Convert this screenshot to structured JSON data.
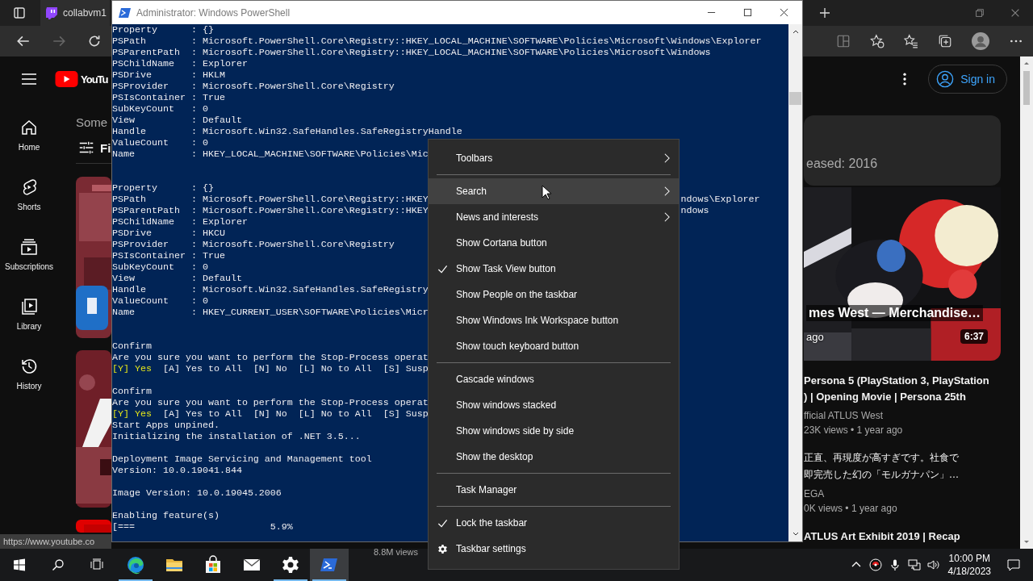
{
  "browser": {
    "tab_title": "collabvm1",
    "status_url": "https://www.youtube.co"
  },
  "youtube": {
    "logo_text": "YouTu",
    "sign_in": "Sign in",
    "sidebar": [
      {
        "kind": "home",
        "label": "Home"
      },
      {
        "kind": "shorts",
        "label": "Shorts"
      },
      {
        "kind": "subscriptions",
        "label": "Subscriptions"
      },
      {
        "kind": "library",
        "label": "Library"
      },
      {
        "kind": "history",
        "label": "History"
      }
    ],
    "left_heading": "Some",
    "left_filter": "Fi",
    "card_text": "eased: 2016",
    "video": {
      "overlay_title": "mes West — Merchandise…",
      "overlay_age": "ago",
      "duration": "6:37"
    },
    "results": [
      {
        "title_lines": [
          "Persona 5 (PlayStation 3, PlayStation",
          ") | Opening Movie | Persona 25th"
        ],
        "channel": "fficial ATLUS West",
        "meta": "23K views • 1 year ago"
      },
      {
        "title_lines": [
          "正直、再現度が高すぎです。社食で",
          "即完売した幻の「モルガナパン」…"
        ],
        "channel": "EGA",
        "meta": "0K views • 1 year ago"
      }
    ],
    "last_title": "ATLUS Art Exhibit 2019 | Recap",
    "bottom_views": "8.8M views"
  },
  "powershell": {
    "title": "Administrator: Windows PowerShell",
    "lines": [
      {
        "kind": "text",
        "text": "Property      : {}"
      },
      {
        "kind": "text",
        "text": "PSPath        : Microsoft.PowerShell.Core\\Registry::HKEY_LOCAL_MACHINE\\SOFTWARE\\Policies\\Microsoft\\Windows\\Explorer"
      },
      {
        "kind": "text",
        "text": "PSParentPath  : Microsoft.PowerShell.Core\\Registry::HKEY_LOCAL_MACHINE\\SOFTWARE\\Policies\\Microsoft\\Windows"
      },
      {
        "kind": "text",
        "text": "PSChildName   : Explorer"
      },
      {
        "kind": "text",
        "text": "PSDrive       : HKLM"
      },
      {
        "kind": "text",
        "text": "PSProvider    : Microsoft.PowerShell.Core\\Registry"
      },
      {
        "kind": "text",
        "text": "PSIsContainer : True"
      },
      {
        "kind": "text",
        "text": "SubKeyCount   : 0"
      },
      {
        "kind": "text",
        "text": "View          : Default"
      },
      {
        "kind": "text",
        "text": "Handle        : Microsoft.Win32.SafeHandles.SafeRegistryHandle"
      },
      {
        "kind": "text",
        "text": "ValueCount    : 0"
      },
      {
        "kind": "text",
        "text": "Name          : HKEY_LOCAL_MACHINE\\SOFTWARE\\Policies\\Mic"
      },
      {
        "kind": "blank"
      },
      {
        "kind": "blank"
      },
      {
        "kind": "text",
        "text": "Property      : {}"
      },
      {
        "kind": "text",
        "text": "PSPath        : Microsoft.PowerShell.Core\\Registry::HKEY",
        "tail": "ndows\\Explorer"
      },
      {
        "kind": "text",
        "text": "PSParentPath  : Microsoft.PowerShell.Core\\Registry::HKEY",
        "tail": "ndows"
      },
      {
        "kind": "text",
        "text": "PSChildName   : Explorer"
      },
      {
        "kind": "text",
        "text": "PSDrive       : HKCU"
      },
      {
        "kind": "text",
        "text": "PSProvider    : Microsoft.PowerShell.Core\\Registry"
      },
      {
        "kind": "text",
        "text": "PSIsContainer : True"
      },
      {
        "kind": "text",
        "text": "SubKeyCount   : 0"
      },
      {
        "kind": "text",
        "text": "View          : Default"
      },
      {
        "kind": "text",
        "text": "Handle        : Microsoft.Win32.SafeHandles.SafeRegistry"
      },
      {
        "kind": "text",
        "text": "ValueCount    : 0"
      },
      {
        "kind": "text",
        "text": "Name          : HKEY_CURRENT_USER\\SOFTWARE\\Policies\\Micr"
      },
      {
        "kind": "blank"
      },
      {
        "kind": "blank"
      },
      {
        "kind": "text",
        "text": "Confirm"
      },
      {
        "kind": "text",
        "text": "Are you sure you want to perform the Stop-Process operat"
      },
      {
        "kind": "choice",
        "default": "[Y] Yes",
        "text": "  [A] Yes to All  [N] No  [L] No to All  [S] Susp"
      },
      {
        "kind": "blank"
      },
      {
        "kind": "text",
        "text": "Confirm"
      },
      {
        "kind": "text",
        "text": "Are you sure you want to perform the Stop-Process operat"
      },
      {
        "kind": "choice",
        "default": "[Y] Yes",
        "text": "  [A] Yes to All  [N] No  [L] No to All  [S] Susp"
      },
      {
        "kind": "text",
        "text": "Start Apps unpined."
      },
      {
        "kind": "text",
        "text": "Initializing the installation of .NET 3.5..."
      },
      {
        "kind": "blank"
      },
      {
        "kind": "text",
        "text": "Deployment Image Servicing and Management tool"
      },
      {
        "kind": "text",
        "text": "Version: 10.0.19041.844"
      },
      {
        "kind": "blank"
      },
      {
        "kind": "text",
        "text": "Image Version: 10.0.19045.2006"
      },
      {
        "kind": "blank"
      },
      {
        "kind": "text",
        "text": "Enabling feature(s)"
      },
      {
        "kind": "text",
        "text": "[===                        5.9%"
      }
    ]
  },
  "context_menu": {
    "items": [
      {
        "kind": "submenu",
        "label": "Toolbars",
        "checked": false,
        "highlighted": false
      },
      {
        "kind": "separator"
      },
      {
        "kind": "submenu",
        "label": "Search",
        "checked": false,
        "highlighted": true
      },
      {
        "kind": "submenu",
        "label": "News and interests",
        "checked": false,
        "highlighted": false
      },
      {
        "kind": "option",
        "label": "Show Cortana button",
        "checked": false,
        "highlighted": false
      },
      {
        "kind": "option",
        "label": "Show Task View button",
        "checked": true,
        "highlighted": false
      },
      {
        "kind": "option",
        "label": "Show People on the taskbar",
        "checked": false,
        "highlighted": false
      },
      {
        "kind": "option",
        "label": "Show Windows Ink Workspace button",
        "checked": false,
        "highlighted": false
      },
      {
        "kind": "option",
        "label": "Show touch keyboard button",
        "checked": false,
        "highlighted": false
      },
      {
        "kind": "separator"
      },
      {
        "kind": "option",
        "label": "Cascade windows",
        "checked": false,
        "highlighted": false
      },
      {
        "kind": "option",
        "label": "Show windows stacked",
        "checked": false,
        "highlighted": false
      },
      {
        "kind": "option",
        "label": "Show windows side by side",
        "checked": false,
        "highlighted": false
      },
      {
        "kind": "option",
        "label": "Show the desktop",
        "checked": false,
        "highlighted": false
      },
      {
        "kind": "separator"
      },
      {
        "kind": "option",
        "label": "Task Manager",
        "checked": false,
        "highlighted": false
      },
      {
        "kind": "separator"
      },
      {
        "kind": "option",
        "label": "Lock the taskbar",
        "checked": true,
        "highlighted": false
      },
      {
        "kind": "settings",
        "label": "Taskbar settings",
        "checked": false,
        "highlighted": false
      }
    ]
  },
  "taskbar": {
    "apps": [
      {
        "kind": "start",
        "running": false,
        "active": false
      },
      {
        "kind": "search",
        "running": false,
        "active": false
      },
      {
        "kind": "taskview",
        "running": false,
        "active": false
      },
      {
        "kind": "edge",
        "running": true,
        "active": false
      },
      {
        "kind": "folder",
        "running": false,
        "active": false
      },
      {
        "kind": "store",
        "running": false,
        "active": false
      },
      {
        "kind": "mail",
        "running": false,
        "active": false
      },
      {
        "kind": "settings",
        "running": true,
        "active": false
      },
      {
        "kind": "powershell",
        "running": true,
        "active": true
      }
    ],
    "time": "10:00 PM",
    "date": "4/18/2023"
  }
}
